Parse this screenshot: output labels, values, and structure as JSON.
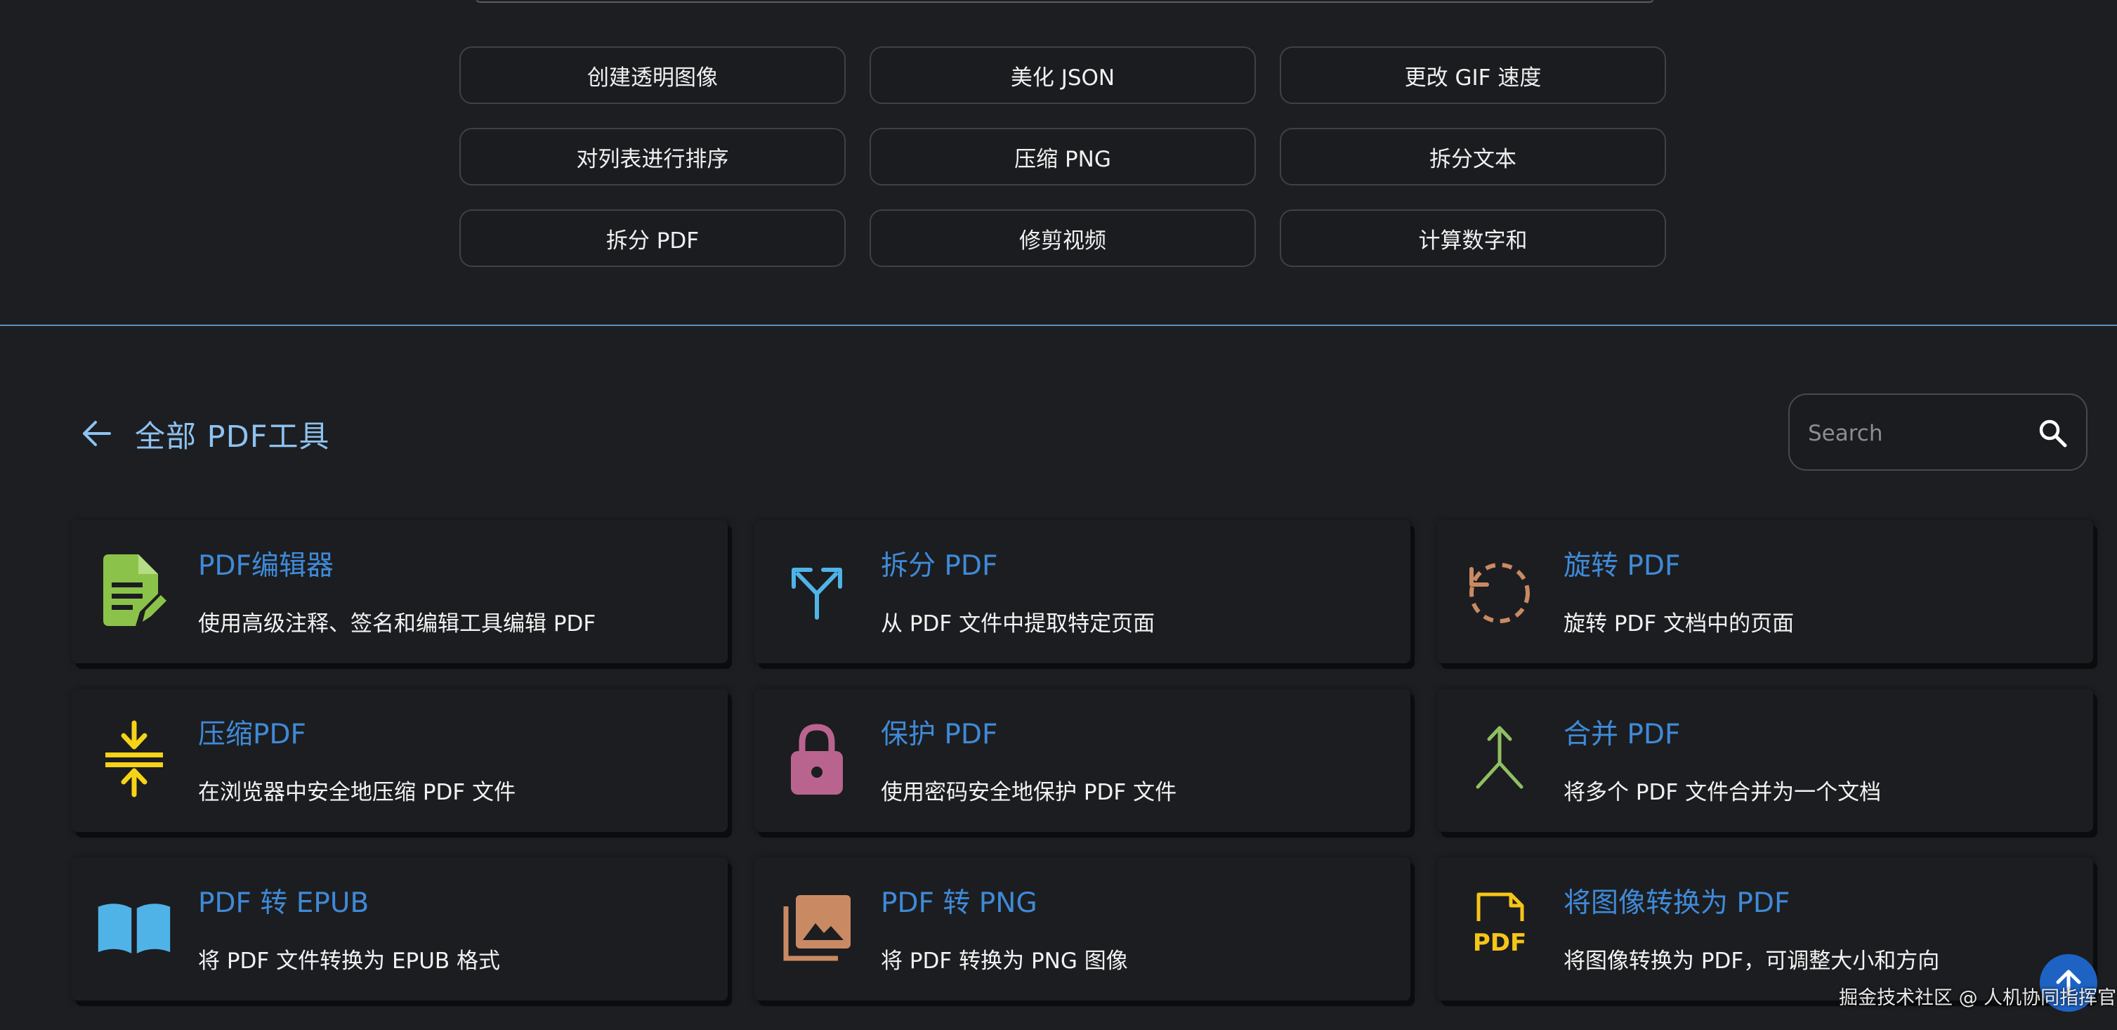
{
  "quick_links": [
    {
      "label": "创建透明图像"
    },
    {
      "label": "美化 JSON"
    },
    {
      "label": "更改 GIF 速度"
    },
    {
      "label": "对列表进行排序"
    },
    {
      "label": "压缩 PNG"
    },
    {
      "label": "拆分文本"
    },
    {
      "label": "拆分 PDF"
    },
    {
      "label": "修剪视频"
    },
    {
      "label": "计算数字和"
    }
  ],
  "header": {
    "title": "全部 PDF工具",
    "back_icon": "arrow-left-icon",
    "search_placeholder": "Search",
    "search_icon": "search-icon"
  },
  "tools": [
    {
      "title": "PDF编辑器",
      "desc": "使用高级注释、签名和编辑工具编辑 PDF",
      "icon": "file-edit-icon",
      "color": "#8bc34a"
    },
    {
      "title": "拆分 PDF",
      "desc": "从 PDF 文件中提取特定页面",
      "icon": "split-arrows-icon",
      "color": "#4fb3e8"
    },
    {
      "title": "旋转 PDF",
      "desc": "旋转 PDF 文档中的页面",
      "icon": "rotate-icon",
      "color": "#c98a63"
    },
    {
      "title": "压缩PDF",
      "desc": "在浏览器中安全地压缩 PDF 文件",
      "icon": "compress-icon",
      "color": "#f5d317"
    },
    {
      "title": "保护 PDF",
      "desc": "使用密码安全地保护 PDF 文件",
      "icon": "lock-icon",
      "color": "#b9648f"
    },
    {
      "title": "合并 PDF",
      "desc": "将多个 PDF 文件合并为一个文档",
      "icon": "merge-icon",
      "color": "#8fbf62"
    },
    {
      "title": "PDF 转 EPUB",
      "desc": "将 PDF 文件转换为 EPUB 格式",
      "icon": "book-open-icon",
      "color": "#4fb3e8"
    },
    {
      "title": "PDF 转 PNG",
      "desc": "将 PDF 转换为 PNG 图像",
      "icon": "image-stack-icon",
      "color": "#c98a63"
    },
    {
      "title": "将图像转换为 PDF",
      "desc": "将图像转换为 PDF，可调整大小和方向",
      "icon": "pdf-file-icon",
      "color": "#f5c518"
    }
  ],
  "pdf_icon_text": "PDF",
  "watermark": "掘金技术社区 @ 人机协同指挥官",
  "colors": {
    "accent": "#3f8ad8",
    "title": "#8ec2f0",
    "fab": "#1e63c4"
  }
}
